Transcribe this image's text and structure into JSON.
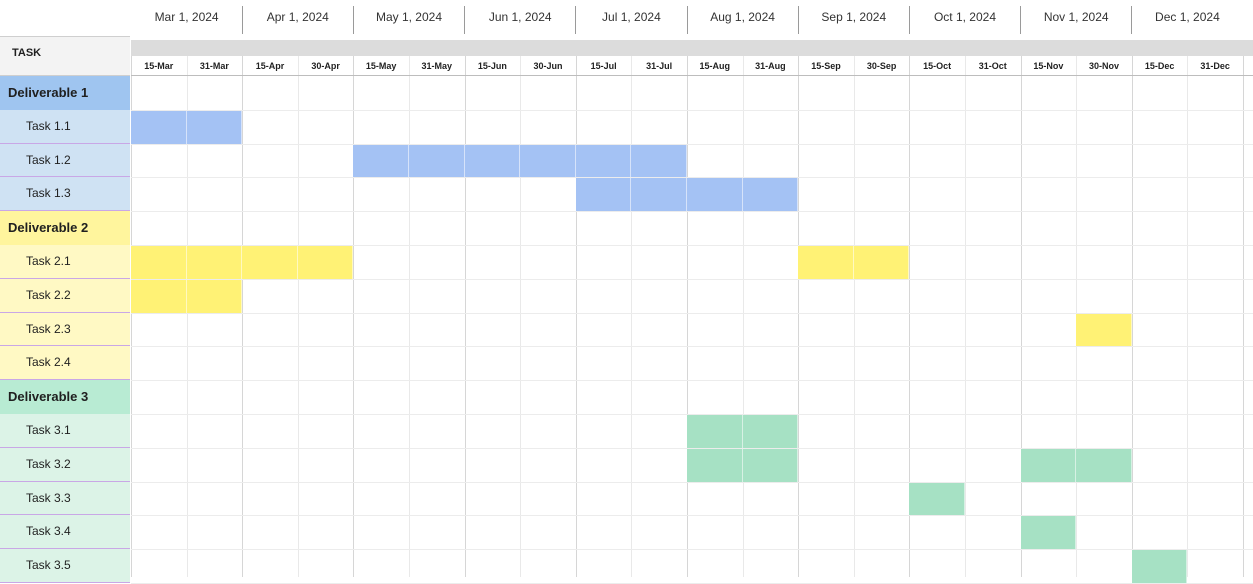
{
  "header": {
    "task_label": "TASK",
    "months": [
      "Mar 1, 2024",
      "Apr 1, 2024",
      "May 1, 2024",
      "Jun 1, 2024",
      "Jul 1, 2024",
      "Aug 1, 2024",
      "Sep 1, 2024",
      "Oct 1, 2024",
      "Nov 1, 2024",
      "Dec 1, 2024"
    ],
    "periods": [
      "15-Mar",
      "31-Mar",
      "15-Apr",
      "30-Apr",
      "15-May",
      "31-May",
      "15-Jun",
      "30-Jun",
      "15-Jul",
      "31-Jul",
      "15-Aug",
      "31-Aug",
      "15-Sep",
      "30-Sep",
      "15-Oct",
      "31-Oct",
      "15-Nov",
      "30-Nov",
      "15-Dec",
      "31-Dec"
    ]
  },
  "colors": {
    "blue": "#a4c2f4",
    "blue_label": "#cfe2f3",
    "blue_deliv": "#9fc5f0",
    "yellow": "#fff275",
    "yellow_label": "#fff9c4",
    "yellow_deliv": "#fff59d",
    "green": "#a6e1c4",
    "green_label": "#dcf3e7",
    "green_deliv": "#b8ebd3",
    "label_divider": "#c9a7e6"
  },
  "rows": [
    {
      "type": "deliverable",
      "label": "Deliverable 1",
      "color": "blue"
    },
    {
      "type": "task",
      "label": "Task 1.1",
      "color": "blue",
      "periods": [
        0,
        1
      ]
    },
    {
      "type": "task",
      "label": "Task 1.2",
      "color": "blue",
      "periods": [
        4,
        5,
        6,
        7,
        8,
        9
      ]
    },
    {
      "type": "task",
      "label": "Task 1.3",
      "color": "blue",
      "periods": [
        8,
        9,
        10,
        11
      ]
    },
    {
      "type": "deliverable",
      "label": "Deliverable 2",
      "color": "yellow"
    },
    {
      "type": "task",
      "label": "Task 2.1",
      "color": "yellow",
      "periods": [
        0,
        1,
        2,
        3,
        12,
        13
      ]
    },
    {
      "type": "task",
      "label": "Task 2.2",
      "color": "yellow",
      "periods": [
        0,
        1
      ]
    },
    {
      "type": "task",
      "label": "Task 2.3",
      "color": "yellow",
      "periods": [
        17
      ]
    },
    {
      "type": "task",
      "label": "Task 2.4",
      "color": "yellow",
      "periods": []
    },
    {
      "type": "deliverable",
      "label": "Deliverable 3",
      "color": "green"
    },
    {
      "type": "task",
      "label": "Task 3.1",
      "color": "green",
      "periods": [
        10,
        11
      ]
    },
    {
      "type": "task",
      "label": "Task 3.2",
      "color": "green",
      "periods": [
        10,
        11,
        16,
        17
      ]
    },
    {
      "type": "task",
      "label": "Task 3.3",
      "color": "green",
      "periods": [
        14
      ]
    },
    {
      "type": "task",
      "label": "Task 3.4",
      "color": "green",
      "periods": [
        16
      ]
    },
    {
      "type": "task",
      "label": "Task 3.5",
      "color": "green",
      "periods": [
        18
      ]
    }
  ]
}
